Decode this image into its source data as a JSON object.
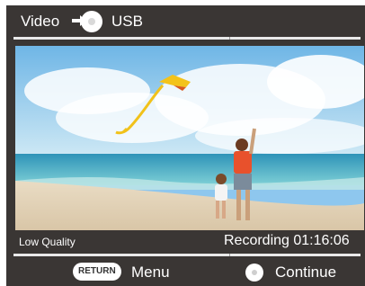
{
  "header": {
    "source_label": "Video",
    "destination_label": "USB",
    "arrow_icon": "arrow-right-icon",
    "disc_icon": "disc-icon"
  },
  "status": {
    "quality_label": "Low Quality",
    "recording_label": "Recording 01:16:06"
  },
  "footer": {
    "return_key_label": "RETURN",
    "menu_label": "Menu",
    "continue_icon": "disc-icon",
    "continue_label": "Continue"
  },
  "colors": {
    "panel_bg": "#3a3634",
    "text": "#ffffff",
    "bar": "#e9e9e9"
  }
}
